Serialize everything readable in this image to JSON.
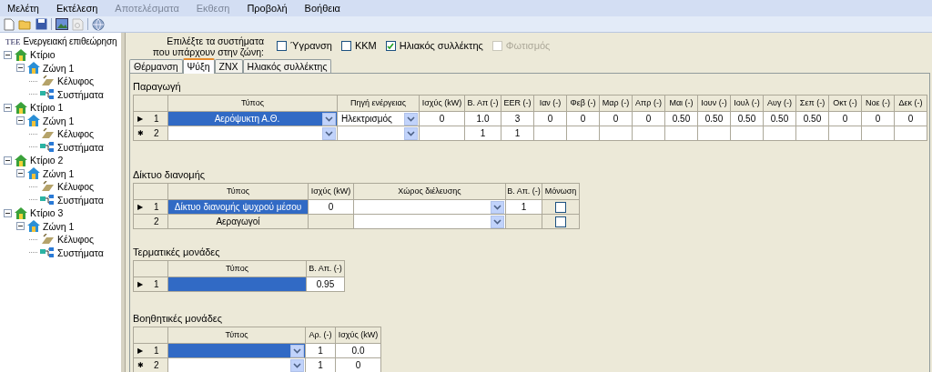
{
  "menu": [
    {
      "label": "Μελέτη",
      "disabled": false
    },
    {
      "label": "Εκτέλεση",
      "disabled": false
    },
    {
      "label": "Αποτελέσματα",
      "disabled": true
    },
    {
      "label": "Εκθεση",
      "disabled": true
    },
    {
      "label": "Προβολή",
      "disabled": false
    },
    {
      "label": "Βοήθεια",
      "disabled": false
    }
  ],
  "tree": {
    "logo": "ΤΕΕ",
    "label": "Ενεργειακή επιθεώρηση",
    "children": [
      {
        "label": "Κτίριο",
        "kind": "building",
        "expanded": true,
        "children": [
          {
            "label": "Ζώνη 1",
            "kind": "zone",
            "expanded": true,
            "children": [
              {
                "label": "Κέλυφος",
                "kind": "shell"
              },
              {
                "label": "Συστήματα",
                "kind": "systems"
              }
            ]
          }
        ]
      },
      {
        "label": "Κτίριο 1",
        "kind": "building",
        "expanded": true,
        "children": [
          {
            "label": "Ζώνη 1",
            "kind": "zone",
            "expanded": true,
            "children": [
              {
                "label": "Κέλυφος",
                "kind": "shell"
              },
              {
                "label": "Συστήματα",
                "kind": "systems"
              }
            ]
          }
        ]
      },
      {
        "label": "Κτίριο 2",
        "kind": "building",
        "expanded": true,
        "children": [
          {
            "label": "Ζώνη 1",
            "kind": "zone",
            "expanded": true,
            "children": [
              {
                "label": "Κέλυφος",
                "kind": "shell"
              },
              {
                "label": "Συστήματα",
                "kind": "systems"
              }
            ]
          }
        ]
      },
      {
        "label": "Κτίριο 3",
        "kind": "building",
        "expanded": true,
        "children": [
          {
            "label": "Ζώνη 1",
            "kind": "zone",
            "expanded": true,
            "children": [
              {
                "label": "Κέλυφος",
                "kind": "shell"
              },
              {
                "label": "Συστήματα",
                "kind": "systems"
              }
            ]
          }
        ]
      }
    ]
  },
  "systems_prompt": "Επιλέξτε τα συστήματα που υπάρχουν στην ζώνη:",
  "systems": [
    {
      "label": "Ύγρανση",
      "checked": false,
      "disabled": false
    },
    {
      "label": "ΚΚΜ",
      "checked": false,
      "disabled": false
    },
    {
      "label": "Ηλιακός συλλέκτης",
      "checked": true,
      "disabled": false
    },
    {
      "label": "Φωτισμός",
      "checked": false,
      "disabled": true
    }
  ],
  "tabs": [
    {
      "label": "Θέρμανση",
      "selected": false
    },
    {
      "label": "Ψύξη",
      "selected": true
    },
    {
      "label": "ΖΝΧ",
      "selected": false
    },
    {
      "label": "Ηλιακός συλλέκτης",
      "selected": false
    }
  ],
  "sections": [
    {
      "title": "Παραγωγή",
      "columns": [
        "Τύπος",
        "Πηγή ενέργειας",
        "Ισχύς (kW)",
        "Β. Απ (-)",
        "EER (-)",
        "Ιαν (-)",
        "Φεβ (-)",
        "Μαρ (-)",
        "Απρ (-)",
        "Μαι (-)",
        "Ιουν (-)",
        "Ιουλ (-)",
        "Αυγ (-)",
        "Σεπ (-)",
        "Οκτ (-)",
        "Νοε (-)",
        "Δεκ (-)"
      ],
      "rows": [
        {
          "marker": "▶",
          "number": "1",
          "cells": [
            {
              "kind": "combo",
              "text": "Αερόψυκτη Α.Θ.",
              "selected": true
            },
            {
              "kind": "combo",
              "text": "Ηλεκτρισμός",
              "selected": false,
              "editable": true
            },
            {
              "kind": "text",
              "text": "0",
              "selected": false,
              "editable": true
            },
            {
              "kind": "text",
              "text": "1.0",
              "selected": false,
              "editable": true
            },
            {
              "kind": "text",
              "text": "3",
              "selected": false,
              "editable": true
            },
            {
              "kind": "text",
              "text": "0",
              "selected": false,
              "editable": true
            },
            {
              "kind": "text",
              "text": "0",
              "selected": false,
              "editable": true
            },
            {
              "kind": "text",
              "text": "0",
              "selected": false,
              "editable": true
            },
            {
              "kind": "text",
              "text": "0",
              "selected": false,
              "editable": true
            },
            {
              "kind": "text",
              "text": "0.50",
              "selected": false,
              "editable": true
            },
            {
              "kind": "text",
              "text": "0.50",
              "selected": false,
              "editable": true
            },
            {
              "kind": "text",
              "text": "0.50",
              "selected": false,
              "editable": true
            },
            {
              "kind": "text",
              "text": "0.50",
              "selected": false,
              "editable": true
            },
            {
              "kind": "text",
              "text": "0.50",
              "selected": false,
              "editable": true
            },
            {
              "kind": "text",
              "text": "0",
              "selected": false,
              "editable": true
            },
            {
              "kind": "text",
              "text": "0",
              "selected": false,
              "editable": true
            },
            {
              "kind": "text",
              "text": "0",
              "selected": false,
              "editable": true
            }
          ]
        },
        {
          "marker": "✱",
          "number": "2",
          "cells": [
            {
              "kind": "combo",
              "selected": false,
              "editable": true
            },
            {
              "kind": "combo",
              "selected": false,
              "editable": true
            },
            {
              "kind": "text",
              "selected": false,
              "editable": true
            },
            {
              "kind": "text",
              "text": "1",
              "selected": false,
              "editable": true
            },
            {
              "kind": "text",
              "text": "1",
              "selected": false,
              "editable": true
            },
            {
              "kind": "text",
              "selected": false,
              "editable": true
            },
            {
              "kind": "text",
              "selected": false,
              "editable": true
            },
            {
              "kind": "text",
              "selected": false,
              "editable": true
            },
            {
              "kind": "text",
              "selected": false,
              "editable": true
            },
            {
              "kind": "text",
              "selected": false,
              "editable": true
            },
            {
              "kind": "text",
              "selected": false,
              "editable": true
            },
            {
              "kind": "text",
              "selected": false,
              "editable": true
            },
            {
              "kind": "text",
              "selected": false,
              "editable": true
            },
            {
              "kind": "text",
              "selected": false,
              "editable": true
            },
            {
              "kind": "text",
              "selected": false,
              "editable": true
            },
            {
              "kind": "text",
              "selected": false,
              "editable": true
            },
            {
              "kind": "text",
              "selected": false,
              "editable": true
            }
          ]
        }
      ]
    },
    {
      "title": "Δίκτυο διανομής",
      "columns": [
        "Τύπος",
        "Ισχύς (kW)",
        "Χώρος διέλευσης",
        "Β. Απ. (-)",
        "Μόνωση"
      ],
      "rows": [
        {
          "marker": "▶",
          "number": "1",
          "cells": [
            {
              "kind": "text",
              "text": "Δίκτυο διανομής ψυχρού μέσου",
              "selected": true
            },
            {
              "kind": "text",
              "text": "0",
              "selected": false,
              "editable": true
            },
            {
              "kind": "combo",
              "selected": false,
              "editable": true
            },
            {
              "kind": "text",
              "text": "1",
              "selected": false,
              "editable": true
            },
            {
              "kind": "check",
              "checked": false,
              "selected": false
            }
          ]
        },
        {
          "number": "2",
          "cells": [
            {
              "kind": "text",
              "text": "Αεραγωγοί",
              "selected": false,
              "editable": false
            },
            {
              "kind": "text",
              "selected": false,
              "editable": false
            },
            {
              "kind": "combo",
              "selected": false,
              "editable": true
            },
            {
              "kind": "text",
              "selected": false,
              "editable": false
            },
            {
              "kind": "check",
              "checked": false,
              "selected": false
            }
          ]
        }
      ]
    },
    {
      "title": "Τερματικές μονάδες",
      "columns": [
        "Τύπος",
        "Β. Απ. (-)"
      ],
      "rows": [
        {
          "marker": "▶",
          "number": "1",
          "cells": [
            {
              "kind": "text",
              "selected": true
            },
            {
              "kind": "text",
              "text": "0.95",
              "selected": false,
              "editable": true
            }
          ]
        }
      ]
    },
    {
      "title": "Βοηθητικές μονάδες",
      "columns": [
        "Τύπος",
        "Αρ. (-)",
        "Ισχύς (kW)"
      ],
      "rows": [
        {
          "marker": "▶",
          "number": "1",
          "cells": [
            {
              "kind": "combo",
              "selected": true
            },
            {
              "kind": "text",
              "text": "1",
              "selected": false,
              "editable": true
            },
            {
              "kind": "text",
              "text": "0.0",
              "selected": false,
              "editable": true
            }
          ]
        },
        {
          "marker": "✱",
          "number": "2",
          "cells": [
            {
              "kind": "combo",
              "selected": false,
              "editable": true
            },
            {
              "kind": "text",
              "text": "1",
              "selected": false,
              "editable": true
            },
            {
              "kind": "text",
              "text": "0",
              "selected": false,
              "editable": true
            }
          ]
        }
      ]
    }
  ]
}
